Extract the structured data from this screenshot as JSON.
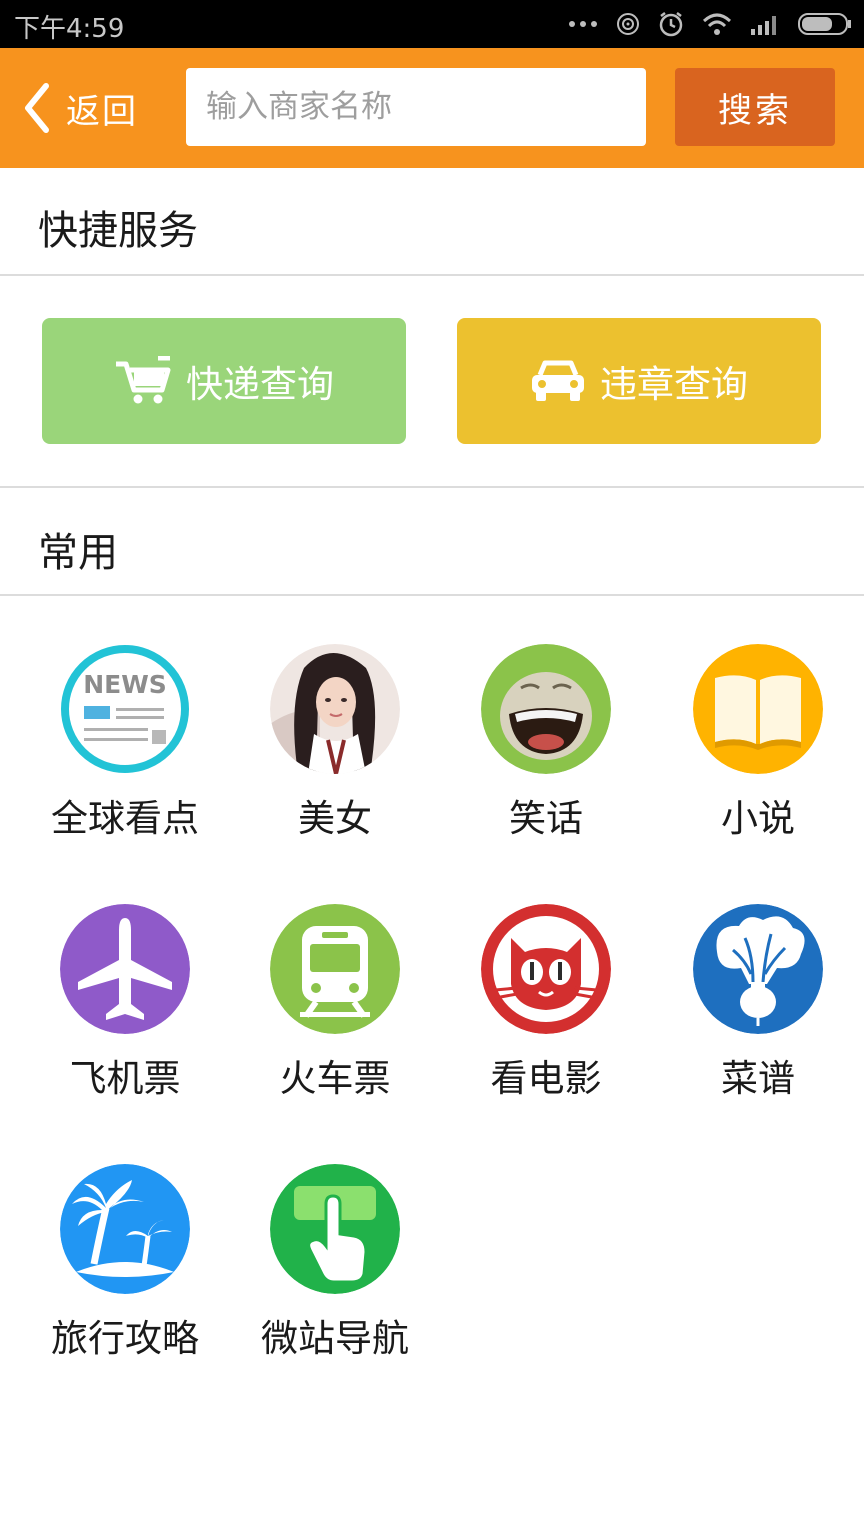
{
  "status_bar": {
    "time": "下午4:59"
  },
  "header": {
    "back_label": "返回",
    "search_placeholder": "输入商家名称",
    "search_value": "",
    "search_button_label": "搜索"
  },
  "quick_services": {
    "title": "快捷服务",
    "buttons": [
      {
        "label": "快递查询",
        "icon": "cart-icon",
        "color": "#9ad57a"
      },
      {
        "label": "违章查询",
        "icon": "car-icon",
        "color": "#ecc12f"
      }
    ]
  },
  "common": {
    "title": "常用",
    "items": [
      {
        "label": "全球看点",
        "icon": "news-icon"
      },
      {
        "label": "美女",
        "icon": "portrait-icon"
      },
      {
        "label": "笑话",
        "icon": "laughing-face-icon"
      },
      {
        "label": "小说",
        "icon": "book-icon"
      },
      {
        "label": "飞机票",
        "icon": "airplane-icon"
      },
      {
        "label": "火车票",
        "icon": "train-icon"
      },
      {
        "label": "看电影",
        "icon": "cat-icon"
      },
      {
        "label": "菜谱",
        "icon": "vegetable-icon"
      },
      {
        "label": "旅行攻略",
        "icon": "palm-tree-icon"
      },
      {
        "label": "微站导航",
        "icon": "finger-tap-icon"
      }
    ]
  },
  "icon_glyph_text": {
    "news": "NEWS"
  },
  "colors": {
    "header_orange": "#f7931e",
    "search_button": "#d9641f",
    "express_green": "#9ad57a",
    "violation_yellow": "#ecc12f"
  }
}
